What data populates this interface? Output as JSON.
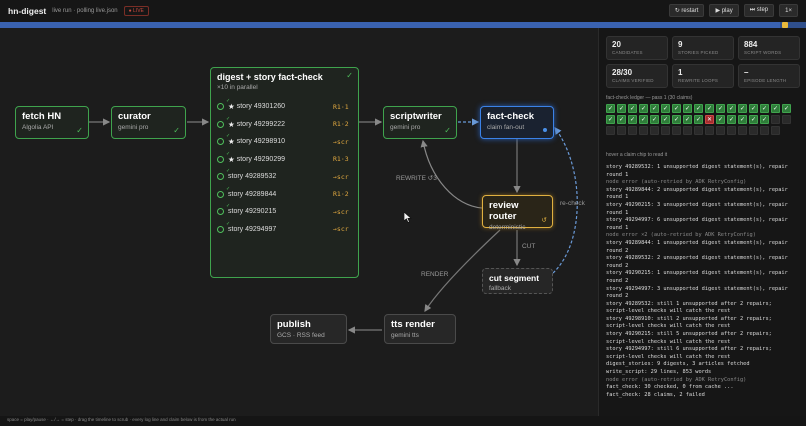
{
  "header": {
    "title": "hn-digest",
    "status": "live run · polling live.json",
    "badge": "● LIVE",
    "buttons": {
      "restart": "↻ restart",
      "play": "▶ play",
      "step": "⏭ step",
      "speed": "1×"
    }
  },
  "nodes": {
    "fetch": {
      "title": "fetch HN",
      "sub": "Algolia API"
    },
    "curator": {
      "title": "curator",
      "sub": "gemini pro"
    },
    "fanout": {
      "title": "digest + story fact-check",
      "sub": "×10 in parallel",
      "stories": [
        {
          "starred": true,
          "name": "story 49301260",
          "tag": "R1·1"
        },
        {
          "starred": true,
          "name": "story 49299222",
          "tag": "R1·2"
        },
        {
          "starred": true,
          "name": "story 49298910",
          "tag": "→scr"
        },
        {
          "starred": true,
          "name": "story 49290299",
          "tag": "R1·3"
        },
        {
          "starred": false,
          "name": "story 49289532",
          "tag": "→scr"
        },
        {
          "starred": false,
          "name": "story 49289844",
          "tag": "R1·2"
        },
        {
          "starred": false,
          "name": "story 49290215",
          "tag": "→scr"
        },
        {
          "starred": false,
          "name": "story 49294997",
          "tag": "→scr"
        }
      ]
    },
    "scriptwriter": {
      "title": "scriptwriter",
      "sub": "gemini pro"
    },
    "factcheck": {
      "title": "fact-check",
      "sub": "claim fan-out"
    },
    "router": {
      "title": "review router",
      "sub": "deterministic"
    },
    "cut": {
      "title": "cut segment",
      "sub": "fallback"
    },
    "tts": {
      "title": "tts render",
      "sub": "gemini tts"
    },
    "publish": {
      "title": "publish",
      "sub": "GCS · RSS feed"
    }
  },
  "edge_labels": {
    "rewrite": "REWRITE ↺3",
    "recheck": "re-check",
    "cut": "CUT",
    "render": "RENDER"
  },
  "stats": [
    {
      "value": "20",
      "label": "CANDIDATES"
    },
    {
      "value": "9",
      "label": "STORIES PICKED"
    },
    {
      "value": "884",
      "label": "SCRIPT WORDS"
    },
    {
      "value": "28/30",
      "label": "CLAIMS VERIFIED"
    },
    {
      "value": "1",
      "label": "REWRITE LOOPS"
    },
    {
      "value": "–",
      "label": "EPISODE LENGTH"
    }
  ],
  "ledger": {
    "title": "fact-check ledger — pass 1 (30 claims)",
    "chips": [
      "ok",
      "ok",
      "ok",
      "ok",
      "ok",
      "ok",
      "ok",
      "ok",
      "ok",
      "ok",
      "ok",
      "ok",
      "ok",
      "ok",
      "ok",
      "ok",
      "ok",
      "ok",
      "ok",
      "ok",
      "ok",
      "ok",
      "ok",
      "ok",
      "ok",
      "ok",
      "bad",
      "ok",
      "ok",
      "ok",
      "ok",
      "ok",
      "empty",
      "empty",
      "empty",
      "empty",
      "empty",
      "empty",
      "empty",
      "empty",
      "empty",
      "empty",
      "empty",
      "empty",
      "empty",
      "empty",
      "empty",
      "empty",
      "empty",
      "empty"
    ],
    "hint": "hover a claim chip to read it"
  },
  "log": [
    {
      "t": "story 49289532: 1 unsupported digest statement(s), repair",
      "err": false
    },
    {
      "t": "round 1",
      "err": false
    },
    {
      "t": "node error (auto-retried by ADK RetryConfig)",
      "err": true
    },
    {
      "t": "story 49289844: 2 unsupported digest statement(s), repair",
      "err": false
    },
    {
      "t": "round 1",
      "err": false
    },
    {
      "t": "story 49290215: 3 unsupported digest statement(s), repair",
      "err": false
    },
    {
      "t": "round 1",
      "err": false
    },
    {
      "t": "story 49294997: 6 unsupported digest statement(s), repair",
      "err": false
    },
    {
      "t": "round 1",
      "err": false
    },
    {
      "t": "node error ×2 (auto-retried by ADK RetryConfig)",
      "err": true
    },
    {
      "t": "story 49289844: 1 unsupported digest statement(s), repair",
      "err": false
    },
    {
      "t": "round 2",
      "err": false
    },
    {
      "t": "story 49289532: 2 unsupported digest statement(s), repair",
      "err": false
    },
    {
      "t": "round 2",
      "err": false
    },
    {
      "t": "story 49290215: 1 unsupported digest statement(s), repair",
      "err": false
    },
    {
      "t": "round 2",
      "err": false
    },
    {
      "t": "story 49294997: 3 unsupported digest statement(s), repair",
      "err": false
    },
    {
      "t": "round 2",
      "err": false
    },
    {
      "t": "story 49289532: still 1 unsupported after 2 repairs;",
      "err": false
    },
    {
      "t": "script-level checks will catch the rest",
      "err": false
    },
    {
      "t": "story 49298910: still 2 unsupported after 2 repairs;",
      "err": false
    },
    {
      "t": "script-level checks will catch the rest",
      "err": false
    },
    {
      "t": "story 49290215: still 5 unsupported after 2 repairs;",
      "err": false
    },
    {
      "t": "script-level checks will catch the rest",
      "err": false
    },
    {
      "t": "story 49294997: still 6 unsupported after 2 repairs;",
      "err": false
    },
    {
      "t": "script-level checks will catch the rest",
      "err": false
    },
    {
      "t": "digest_stories: 9 digests, 3 articles fetched",
      "err": false
    },
    {
      "t": "write_script: 29 lines, 853 words",
      "err": false
    },
    {
      "t": "node error (auto-retried by ADK RetryConfig)",
      "err": true
    },
    {
      "t": "fact_check: 30 checked, 0 from cache ...",
      "err": false
    },
    {
      "t": "fact_check: 28 claims, 2 failed",
      "err": false
    }
  ],
  "footer": {
    "hint": "space = play/pause · ←/→ = step · drag the timeline to scrub · every log line and claim below is from the actual run"
  },
  "colors": {
    "done": "#3fa34d",
    "active": "#3b82e8",
    "router": "#e0b040",
    "timeline": "#3a62b0"
  }
}
